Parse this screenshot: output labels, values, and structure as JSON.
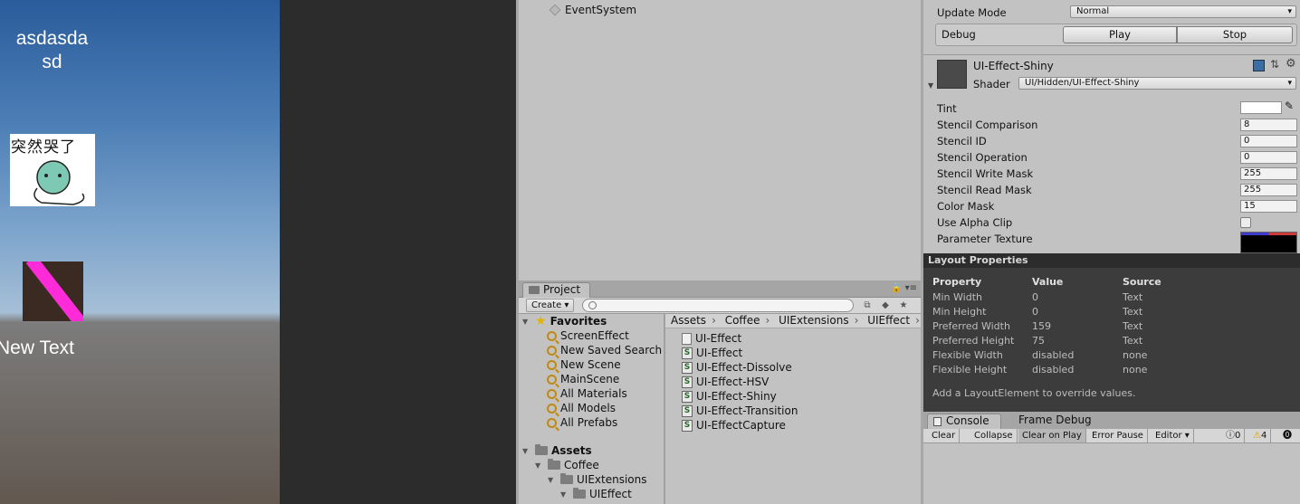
{
  "game": {
    "text_top_line1": "asdasda",
    "text_top_line2": "sd",
    "meme_text": "突然哭了",
    "new_text": "New Text"
  },
  "hierarchy": {
    "items": [
      {
        "label": "EventSystem"
      }
    ]
  },
  "inspector": {
    "update_mode_label": "Update Mode",
    "update_mode_value": "Normal",
    "debug_label": "Debug",
    "play_label": "Play",
    "stop_label": "Stop",
    "material_name": "UI-Effect-Shiny",
    "shader_label": "Shader",
    "shader_value": "UI/Hidden/UI-Effect-Shiny",
    "properties": [
      {
        "label": "Tint",
        "value": "",
        "kind": "color"
      },
      {
        "label": "Stencil Comparison",
        "value": "8",
        "kind": "number"
      },
      {
        "label": "Stencil ID",
        "value": "0",
        "kind": "number"
      },
      {
        "label": "Stencil Operation",
        "value": "0",
        "kind": "number"
      },
      {
        "label": "Stencil Write Mask",
        "value": "255",
        "kind": "number"
      },
      {
        "label": "Stencil Read Mask",
        "value": "255",
        "kind": "number"
      },
      {
        "label": "Color Mask",
        "value": "15",
        "kind": "number"
      },
      {
        "label": "Use Alpha Clip",
        "value": "",
        "kind": "checkbox"
      },
      {
        "label": "Parameter Texture",
        "value": "",
        "kind": "texture"
      }
    ]
  },
  "layout_properties": {
    "title": "Layout Properties",
    "headers": [
      "Property",
      "Value",
      "Source"
    ],
    "rows": [
      [
        "Min Width",
        "0",
        "Text"
      ],
      [
        "Min Height",
        "0",
        "Text"
      ],
      [
        "Preferred Width",
        "159",
        "Text"
      ],
      [
        "Preferred Height",
        "75",
        "Text"
      ],
      [
        "Flexible Width",
        "disabled",
        "none"
      ],
      [
        "Flexible Height",
        "disabled",
        "none"
      ]
    ],
    "footer": "Add a LayoutElement to override values."
  },
  "project": {
    "tab_label": "Project",
    "create_label": "Create",
    "favorites_label": "Favorites",
    "favorites": [
      "ScreenEffect",
      "New Saved Search",
      "New Scene",
      "MainScene",
      "All Materials",
      "All Models",
      "All Prefabs"
    ],
    "assets_label": "Assets",
    "tree": [
      "Coffee",
      "UIExtensions",
      "UIEffect"
    ],
    "breadcrumb": [
      "Assets",
      "Coffee",
      "UIExtensions",
      "UIEffect"
    ],
    "files": [
      {
        "name": "UI-Effect",
        "icon": "document-icon"
      },
      {
        "name": "UI-Effect",
        "icon": "csharp-icon"
      },
      {
        "name": "UI-Effect-Dissolve",
        "icon": "csharp-icon"
      },
      {
        "name": "UI-Effect-HSV",
        "icon": "csharp-icon"
      },
      {
        "name": "UI-Effect-Shiny",
        "icon": "csharp-icon"
      },
      {
        "name": "UI-Effect-Transition",
        "icon": "csharp-icon"
      },
      {
        "name": "UI-EffectCapture",
        "icon": "csharp-icon"
      }
    ]
  },
  "console": {
    "tab_label": "Console",
    "frame_debug_label": "Frame Debug",
    "buttons": [
      "Clear",
      "Collapse",
      "Clear on Play",
      "Error Pause",
      "Editor"
    ],
    "info_count": "0",
    "warning_count": "4"
  }
}
